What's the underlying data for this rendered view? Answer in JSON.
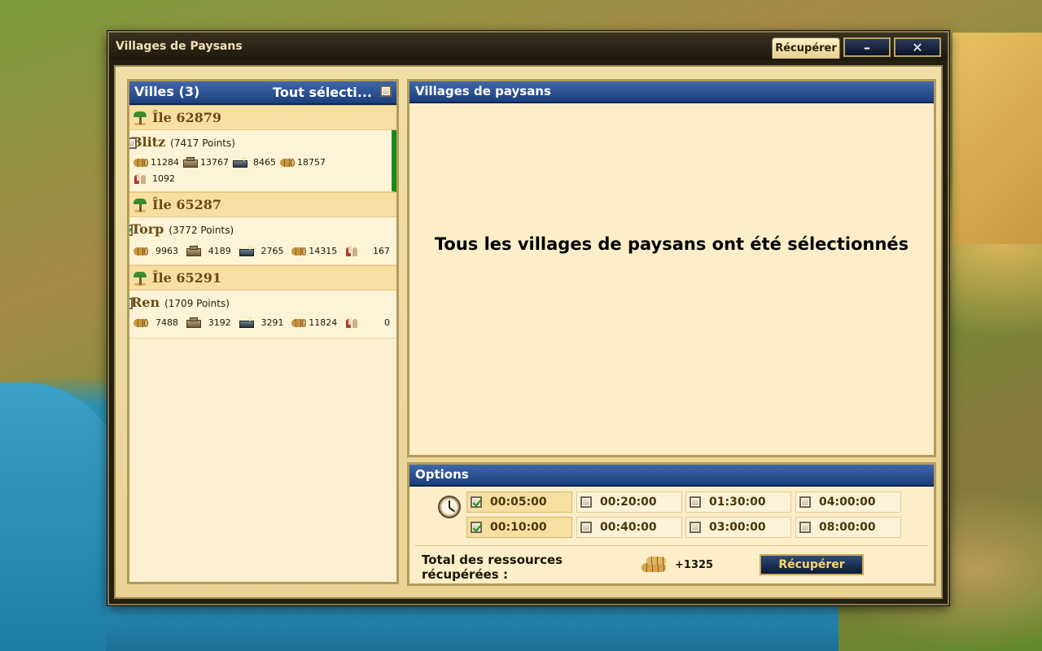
{
  "window": {
    "title": "Villages de Paysans",
    "tab_label": "Récupérer",
    "minimize_symbol": "–",
    "close_symbol": "✕"
  },
  "left_panel": {
    "title": "Villes (3)",
    "select_all_label": "Tout sélecti...",
    "islands": [
      {
        "name": "Île 62879",
        "cities": [
          {
            "name": "Blitz",
            "points": "(7417 Points)",
            "wood": "11284",
            "stone": "13767",
            "silver": "8465",
            "favor": "18757",
            "population": "1092",
            "selected": false,
            "active": true
          }
        ]
      },
      {
        "name": "Île 65287",
        "cities": [
          {
            "name": "Torp",
            "points": "(3772 Points)",
            "wood": "9963",
            "stone": "4189",
            "silver": "2765",
            "favor": "14315",
            "population": "167",
            "selected": true,
            "active": false
          }
        ]
      },
      {
        "name": "Île 65291",
        "cities": [
          {
            "name": "Ren",
            "points": "(1709 Points)",
            "wood": "7488",
            "stone": "3192",
            "silver": "3291",
            "favor": "11824",
            "population": "0",
            "selected": false,
            "active": false
          }
        ]
      }
    ]
  },
  "main_panel": {
    "title": "Villages de paysans",
    "message": "Tous les villages de paysans ont été sélectionnés"
  },
  "options": {
    "title": "Options",
    "times": [
      {
        "label": "00:05:00",
        "checked": true
      },
      {
        "label": "00:20:00",
        "checked": false
      },
      {
        "label": "01:30:00",
        "checked": false
      },
      {
        "label": "04:00:00",
        "checked": false
      },
      {
        "label": "00:10:00",
        "checked": true
      },
      {
        "label": "00:40:00",
        "checked": false
      },
      {
        "label": "03:00:00",
        "checked": false
      },
      {
        "label": "08:00:00",
        "checked": false
      }
    ],
    "total_label": "Total des ressources récupérées :",
    "total_value": "+1325",
    "button_label": "Récupérer"
  },
  "icons": {
    "clock": "clock-icon",
    "island": "palm-island-icon",
    "wood": "wood-icon",
    "stone": "stone-icon",
    "silver": "silver-icon",
    "favor": "resources-icon",
    "population": "population-icon"
  },
  "colors": {
    "header_blue": "#1c3f7d",
    "selected_bar": "#1a8a1a",
    "button_text": "#ffd66a"
  }
}
